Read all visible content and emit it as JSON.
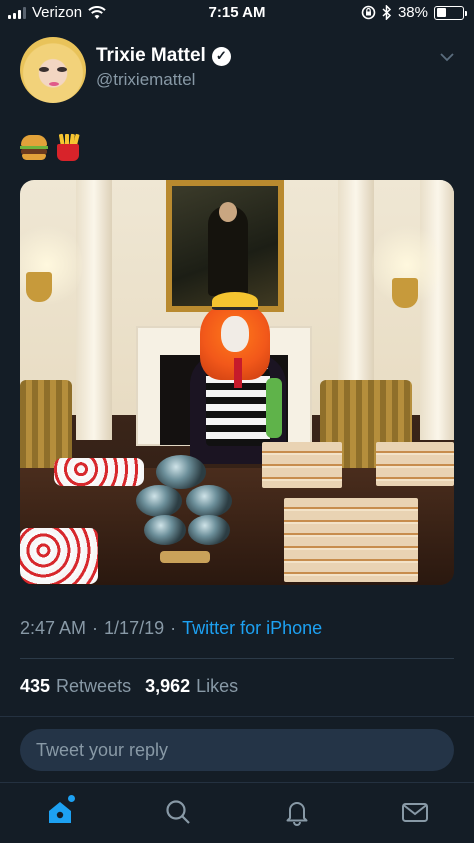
{
  "status_bar": {
    "carrier": "Verizon",
    "time": "7:15 AM",
    "battery_percent": "38%",
    "battery_level": 0.38,
    "icons": [
      "signal-icon",
      "wifi-icon",
      "screen-lock-icon",
      "bluetooth-icon",
      "battery-icon"
    ]
  },
  "tweet": {
    "display_name": "Trixie Mattel",
    "handle": "@trixiemattel",
    "verified": true,
    "body_emoji": [
      "hamburger-emoji",
      "french-fries-emoji"
    ],
    "media": {
      "type": "photo",
      "subject": "costumed figure beside a table of fast food"
    },
    "timestamp_time": "2:47 AM",
    "separator": "·",
    "timestamp_date": "1/17/19",
    "source": "Twitter for iPhone",
    "retweets_count": "435",
    "retweets_label": "Retweets",
    "likes_count": "3,962",
    "likes_label": "Likes"
  },
  "reply": {
    "placeholder": "Tweet your reply"
  },
  "tab_bar": {
    "tabs": [
      {
        "name": "home-icon",
        "active": true
      },
      {
        "name": "search-icon",
        "active": false
      },
      {
        "name": "notifications-icon",
        "active": false
      },
      {
        "name": "messages-icon",
        "active": false
      }
    ]
  },
  "colors": {
    "background": "#141d26",
    "accent": "#1da1f2",
    "secondary_text": "#8899a6",
    "input_bg": "#243447"
  }
}
